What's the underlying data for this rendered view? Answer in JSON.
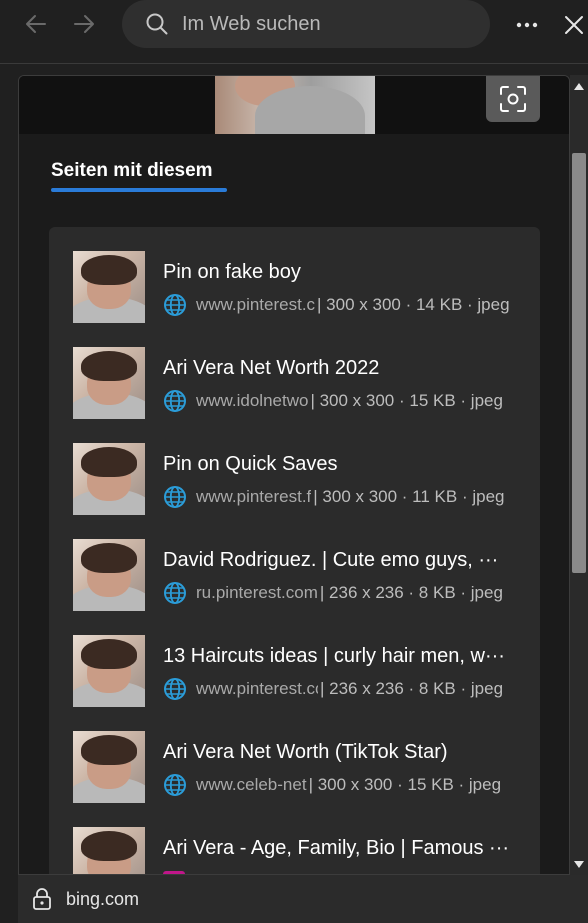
{
  "browser": {
    "search_placeholder": "Im Web suchen",
    "icons": [
      "back-arrow-icon",
      "forward-arrow-icon",
      "search-icon",
      "more-icon",
      "close-icon"
    ]
  },
  "panel": {
    "section_title": "Seiten mit diesem",
    "accent_color": "#2a7bd8"
  },
  "results": [
    {
      "title": "Pin on fake boy",
      "domain": "www.pinterest.c",
      "dims": "| 300 x 300 · 14 KB · jpeg"
    },
    {
      "title": "Ari Vera Net Worth 2022",
      "domain": "www.idolnetwo",
      "dims": "| 300 x 300 · 15 KB · jpeg"
    },
    {
      "title": "Pin on Quick Saves",
      "domain": "www.pinterest.f",
      "dims": "| 300 x 300 · 11 KB · jpeg"
    },
    {
      "title": "David Rodriguez. | Cute emo guys, ···",
      "domain": "ru.pinterest.com",
      "dims": "| 236 x 236 · 8 KB · jpeg"
    },
    {
      "title": "13 Haircuts ideas | curly hair men, w···",
      "domain": "www.pinterest.cc",
      "dims": "| 236 x 236 · 8 KB · jpeg"
    },
    {
      "title": "Ari Vera Net Worth (TikTok Star)",
      "domain": "www.celeb-net",
      "dims": "| 300 x 300 · 15 KB · jpeg"
    },
    {
      "title": "Ari Vera - Age, Family, Bio | Famous ···",
      "domain": "",
      "dims": ""
    }
  ],
  "statusbar": {
    "url": "bing.com"
  }
}
